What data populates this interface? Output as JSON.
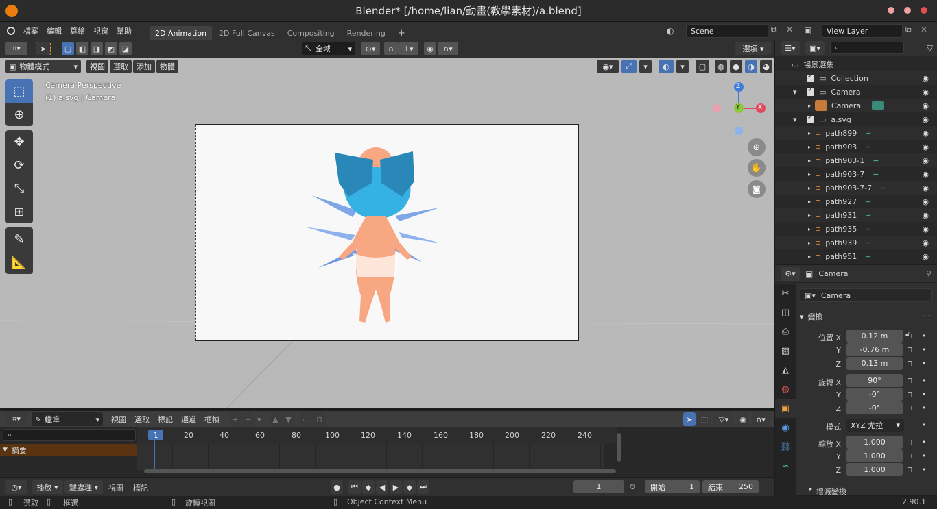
{
  "title_bar": {
    "title": "Blender* [/home/lian/動畫(教學素材)/a.blend]"
  },
  "menu": [
    "檔案",
    "編輯",
    "算繪",
    "視窗",
    "幫助"
  ],
  "workspace_tabs": [
    "2D Animation",
    "2D Full Canvas",
    "Compositing",
    "Rendering"
  ],
  "scene": {
    "name": "Scene",
    "view_layer": "View Layer"
  },
  "viewport": {
    "transform_orientation": "全域",
    "options_label": "選項",
    "mode": "物體模式",
    "header_menus": [
      "視圖",
      "選取",
      "添加",
      "物體"
    ],
    "info_line1": "Camera Perspective",
    "info_line2": "(1) a.svg | Camera",
    "gizmo": {
      "z": "Z",
      "y": "Y",
      "x": "X"
    }
  },
  "outliner": {
    "root": "場景選集",
    "rows": [
      {
        "label": "Collection"
      },
      {
        "label": "Camera"
      },
      {
        "label": "Camera"
      },
      {
        "label": "a.svg"
      },
      {
        "label": "path899"
      },
      {
        "label": "path903"
      },
      {
        "label": "path903-1"
      },
      {
        "label": "path903-7"
      },
      {
        "label": "path903-7-7"
      },
      {
        "label": "path927"
      },
      {
        "label": "path931"
      },
      {
        "label": "path935"
      },
      {
        "label": "path939"
      },
      {
        "label": "path951"
      }
    ]
  },
  "properties": {
    "header": "Camera",
    "object_name": "Camera",
    "panel_title": "變換",
    "location_label": "位置 X",
    "location": [
      "0.12 m",
      "-0.76 m",
      "0.13 m"
    ],
    "rotation_label": "旋轉 X",
    "rotation": [
      "90°",
      "-0°",
      "-0°"
    ],
    "mode_label": "模式",
    "rotation_mode": "XYZ 尤拉",
    "scale_label": "縮放 X",
    "scale": [
      "1.000",
      "1.000",
      "1.000"
    ],
    "axis_y": "Y",
    "axis_z": "Z",
    "delta_panel": "增減變換"
  },
  "timeline": {
    "header_menus": [
      "視圖",
      "選取",
      "標記",
      "通道",
      "框幀"
    ],
    "brush": "蠟筆",
    "ruler": [
      "20",
      "40",
      "60",
      "80",
      "100",
      "120",
      "140",
      "160",
      "180",
      "200",
      "220",
      "240"
    ],
    "current_frame_marker": "1",
    "summary": "摘要"
  },
  "playback": {
    "playback_menu": "播放",
    "keying_menu": "鍵處理",
    "view_menu": "視圖",
    "markers_menu": "標記",
    "current_frame": "1",
    "start_label": "開始",
    "start": "1",
    "end_label": "結束",
    "end": "250"
  },
  "status": {
    "select": "選取",
    "box_select": "框選",
    "rotate_view": "旋轉視圖",
    "context_menu": "Object Context Menu",
    "version": "2.90.1"
  }
}
